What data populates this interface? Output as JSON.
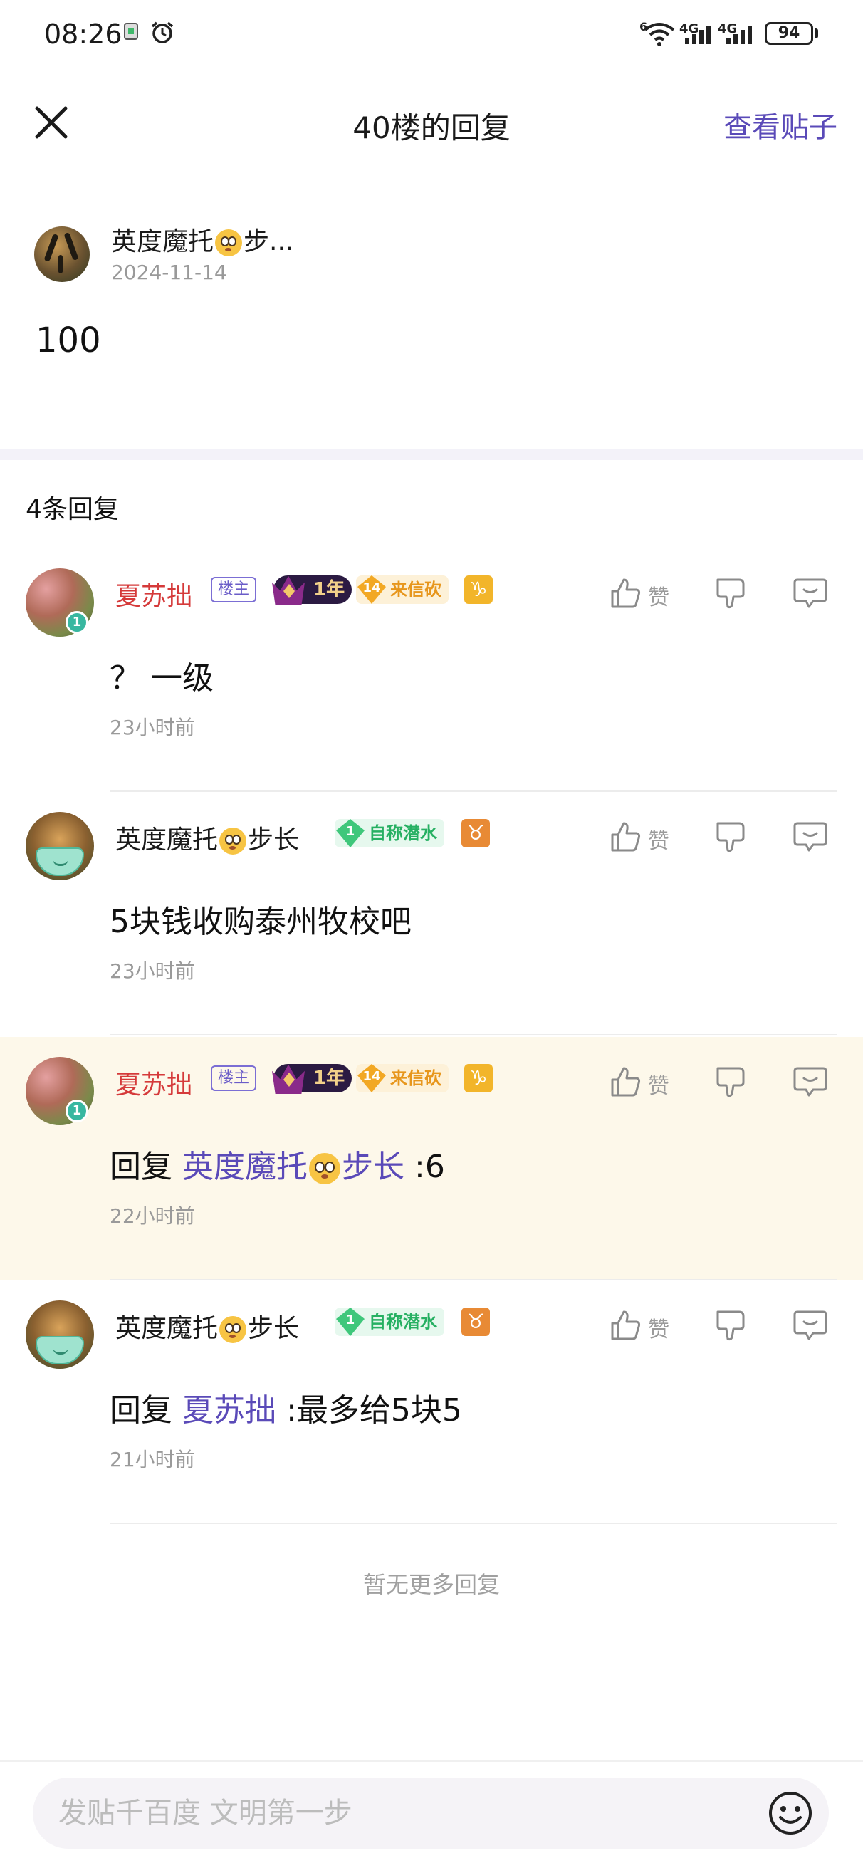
{
  "status_bar": {
    "time": "08:26",
    "network_1": "4G",
    "network_2": "4G",
    "wifi_label": "6",
    "battery": "94"
  },
  "header": {
    "title": "40楼的回复",
    "view_post_label": "查看贴子"
  },
  "original_post": {
    "author_prefix": "英度魔托",
    "author_suffix": "步...",
    "date": "2024-11-14",
    "content": "100"
  },
  "reply_count_label": "4条回复",
  "replies": [
    {
      "author": "夏苏拙",
      "owner_tag": "楼主",
      "year_badge": "1年",
      "title_badge_level": "14",
      "title_badge": "来信砍",
      "zodiac": "♑",
      "like_label": "赞",
      "text": "？ 一级",
      "time": "23小时前"
    },
    {
      "author_prefix": "英度魔托",
      "author_suffix": "步长",
      "title_badge_level": "1",
      "title_badge": "自称潜水",
      "zodiac": "♉",
      "like_label": "赞",
      "text": "5块钱收购泰州牧校吧",
      "time": "23小时前"
    },
    {
      "author": "夏苏拙",
      "owner_tag": "楼主",
      "year_badge": "1年",
      "title_badge_level": "14",
      "title_badge": "来信砍",
      "zodiac": "♑",
      "like_label": "赞",
      "reply_prefix": "回复",
      "mention_prefix": "英度魔托",
      "mention_suffix": "步长",
      "text_after": " :6",
      "time": "22小时前"
    },
    {
      "author_prefix": "英度魔托",
      "author_suffix": "步长",
      "title_badge_level": "1",
      "title_badge": "自称潜水",
      "zodiac": "♉",
      "like_label": "赞",
      "reply_prefix": "回复",
      "mention": "夏苏拙",
      "text_after": " :最多给5块5",
      "time": "21小时前"
    }
  ],
  "no_more_label": "暂无更多回复",
  "input": {
    "placeholder": "发贴千百度 文明第一步"
  },
  "colors": {
    "accent": "#5a4ab8",
    "owner_name": "#d53a3a",
    "highlight_row": "#fdf8ea"
  },
  "icons": [
    "close-icon",
    "thumbs-up-icon",
    "thumbs-down-icon",
    "comment-icon",
    "emoji-icon",
    "wifi-icon",
    "signal-icon",
    "alarm-icon"
  ]
}
